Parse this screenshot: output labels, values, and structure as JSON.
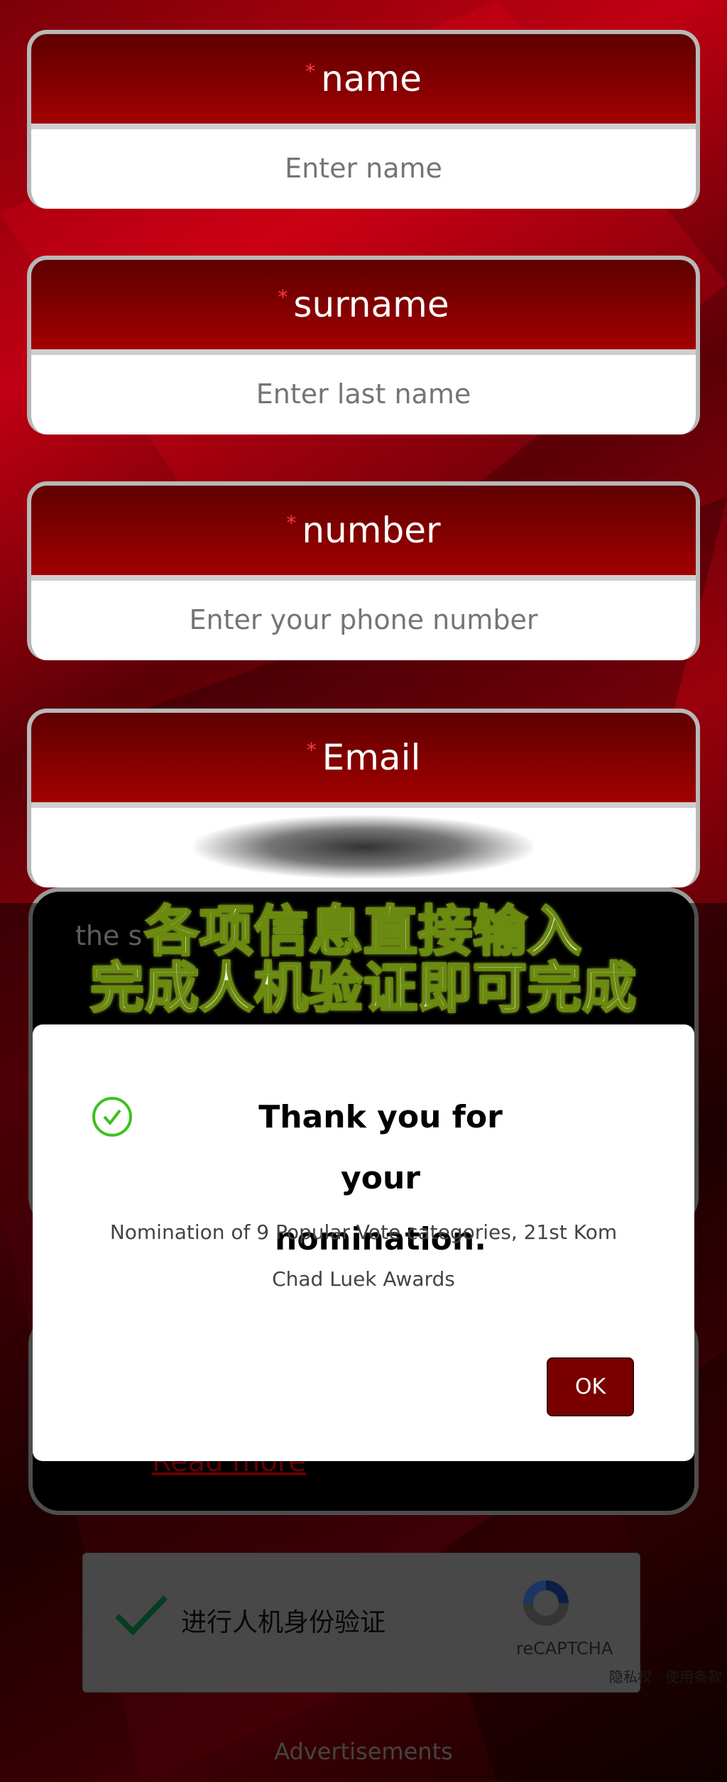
{
  "form": {
    "fields": [
      {
        "label": "name",
        "required_mark": "*",
        "placeholder": "Enter name",
        "value": ""
      },
      {
        "label": "surname",
        "required_mark": "*",
        "placeholder": "Enter last name",
        "value": ""
      },
      {
        "label": "number",
        "required_mark": "*",
        "placeholder": "Enter your phone number",
        "value": ""
      },
      {
        "label": "Email",
        "required_mark": "*",
        "placeholder": "",
        "value": "(redacted)"
      }
    ]
  },
  "background_card": {
    "text_fragment": "the s",
    "read_more": "Read more"
  },
  "caption": {
    "line1": "各项信息直接输入",
    "line2": "完成人机验证即可完成"
  },
  "dialog": {
    "icon": "check-circle-icon",
    "title": "Thank you for your nomination.",
    "message": "Nomination of 9 Popular Vote categories, 21st Kom Chad Luek Awards",
    "ok": "OK"
  },
  "recaptcha": {
    "label": "进行人机身份验证",
    "brand": "reCAPTCHA",
    "privacy": "隐私权",
    "terms": "使用条款",
    "separator": "·",
    "checked": true
  },
  "footer": {
    "ads": "Advertisements"
  },
  "colors": {
    "header_red": "#a30000",
    "ok_button": "#7a0000",
    "check_green": "#3cc21e",
    "captcha_check": "#0a8a4a"
  }
}
